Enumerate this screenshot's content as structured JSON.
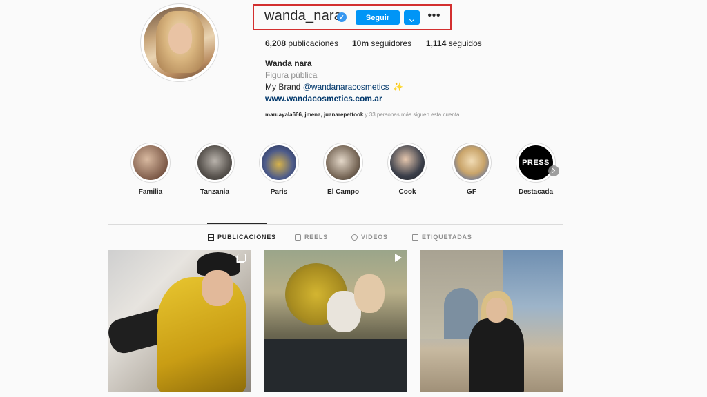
{
  "profile": {
    "username": "wanda_nara",
    "follow_label": "Seguir",
    "more_label": "•••",
    "stats": {
      "posts_count": "6,208",
      "posts_label": "publicaciones",
      "followers_count": "10m",
      "followers_label": "seguidores",
      "following_count": "1,114",
      "following_label": "seguidos"
    },
    "bio": {
      "name": "Wanda nara",
      "category": "Figura pública",
      "brand_prefix": "My Brand ",
      "brand_mention": "@wandanaracosmetics",
      "link": "www.wandacosmetics.com.ar",
      "followed_by_names": "maruayala666, jmena, juanarepettook",
      "followed_by_suffix": " y 33 personas más siguen esta cuenta"
    }
  },
  "highlights": [
    {
      "label": "Familia"
    },
    {
      "label": "Tanzania"
    },
    {
      "label": "Paris"
    },
    {
      "label": "El Campo"
    },
    {
      "label": "Cook"
    },
    {
      "label": "GF"
    },
    {
      "label": "Destacada",
      "cover_text": "PRESS"
    }
  ],
  "tabs": [
    {
      "label": "PUBLICACIONES",
      "icon": "grid-icon",
      "active": true
    },
    {
      "label": "REELS",
      "icon": "reels-icon"
    },
    {
      "label": "VIDEOS",
      "icon": "video-icon"
    },
    {
      "label": "ETIQUETADAS",
      "icon": "tagged-icon"
    }
  ],
  "posts": [
    {
      "type": "carousel",
      "type_icon": "multi-photo-icon"
    },
    {
      "type": "video",
      "type_icon": "play-icon"
    },
    {
      "type": "photo"
    }
  ],
  "colors": {
    "accent": "#0095f6",
    "verified": "#3897f0",
    "highlight_border": "#d32f2f",
    "link": "#00376b"
  }
}
